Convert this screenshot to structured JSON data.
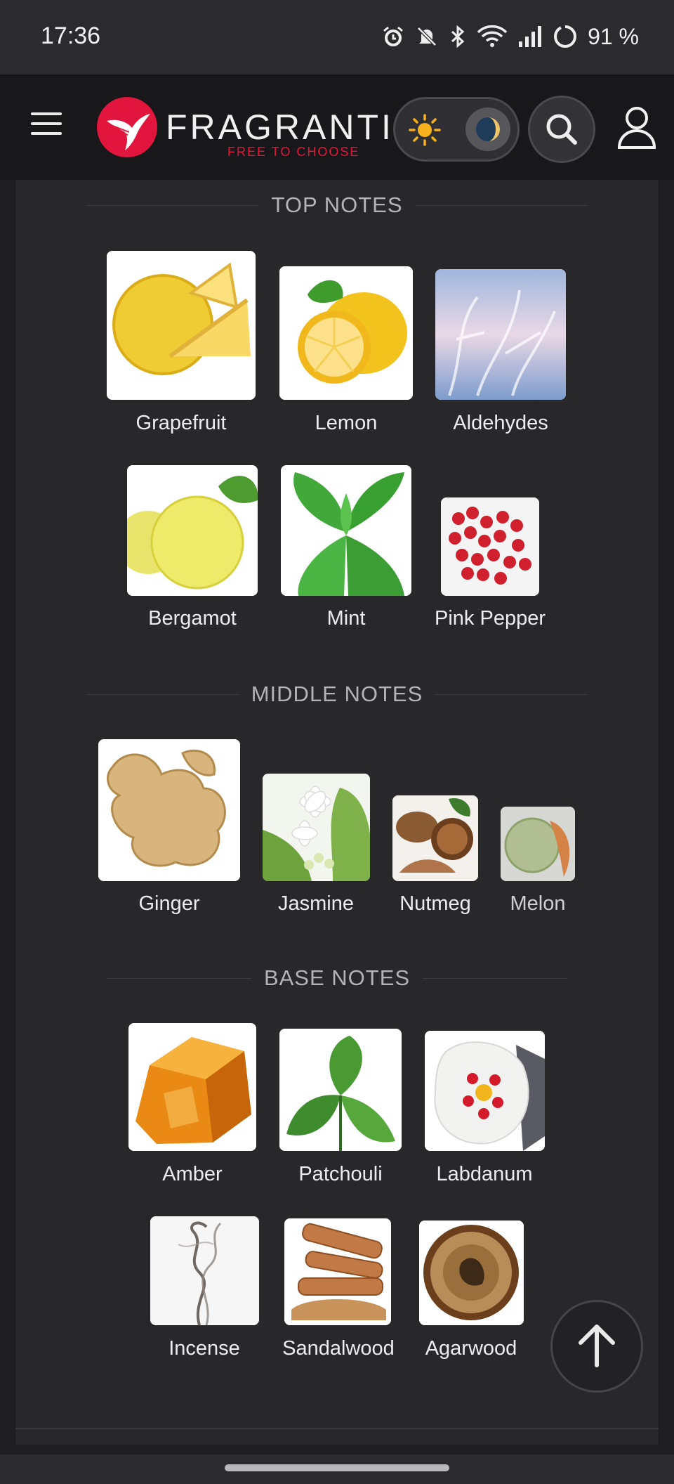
{
  "status_bar": {
    "time": "17:36",
    "battery": "91 %",
    "icons": [
      "alarm-icon",
      "mute-icon",
      "bluetooth-icon",
      "wifi-icon",
      "signal-icon",
      "battery-icon"
    ]
  },
  "header": {
    "brand": "FRAGRANTICA",
    "tagline": "FREE TO CHOOSE",
    "icons": [
      "menu-icon",
      "hummingbird-logo",
      "sun-icon",
      "moon-icon",
      "search-icon",
      "user-icon"
    ],
    "accent": "#e2153c"
  },
  "pyramid": {
    "top": {
      "title": "TOP NOTES",
      "notes": [
        {
          "label": "Grapefruit",
          "icon": "grapefruit-image"
        },
        {
          "label": "Lemon",
          "icon": "lemon-image"
        },
        {
          "label": "Aldehydes",
          "icon": "aldehydes-image"
        },
        {
          "label": "Bergamot",
          "icon": "bergamot-image"
        },
        {
          "label": "Mint",
          "icon": "mint-image"
        },
        {
          "label": "Pink Pepper",
          "icon": "pink-pepper-image"
        }
      ]
    },
    "middle": {
      "title": "MIDDLE NOTES",
      "notes": [
        {
          "label": "Ginger",
          "icon": "ginger-image"
        },
        {
          "label": "Jasmine",
          "icon": "jasmine-image"
        },
        {
          "label": "Nutmeg",
          "icon": "nutmeg-image"
        },
        {
          "label": "Melon",
          "icon": "melon-image"
        }
      ]
    },
    "base": {
      "title": "BASE NOTES",
      "notes": [
        {
          "label": "Amber",
          "icon": "amber-image"
        },
        {
          "label": "Patchouli",
          "icon": "patchouli-image"
        },
        {
          "label": "Labdanum",
          "icon": "labdanum-image"
        },
        {
          "label": "Incense",
          "icon": "incense-image"
        },
        {
          "label": "Sandalwood",
          "icon": "sandalwood-image"
        },
        {
          "label": "Agarwood",
          "icon": "agarwood-image"
        }
      ]
    }
  },
  "scroll_top": {
    "icon": "arrow-up-icon"
  }
}
